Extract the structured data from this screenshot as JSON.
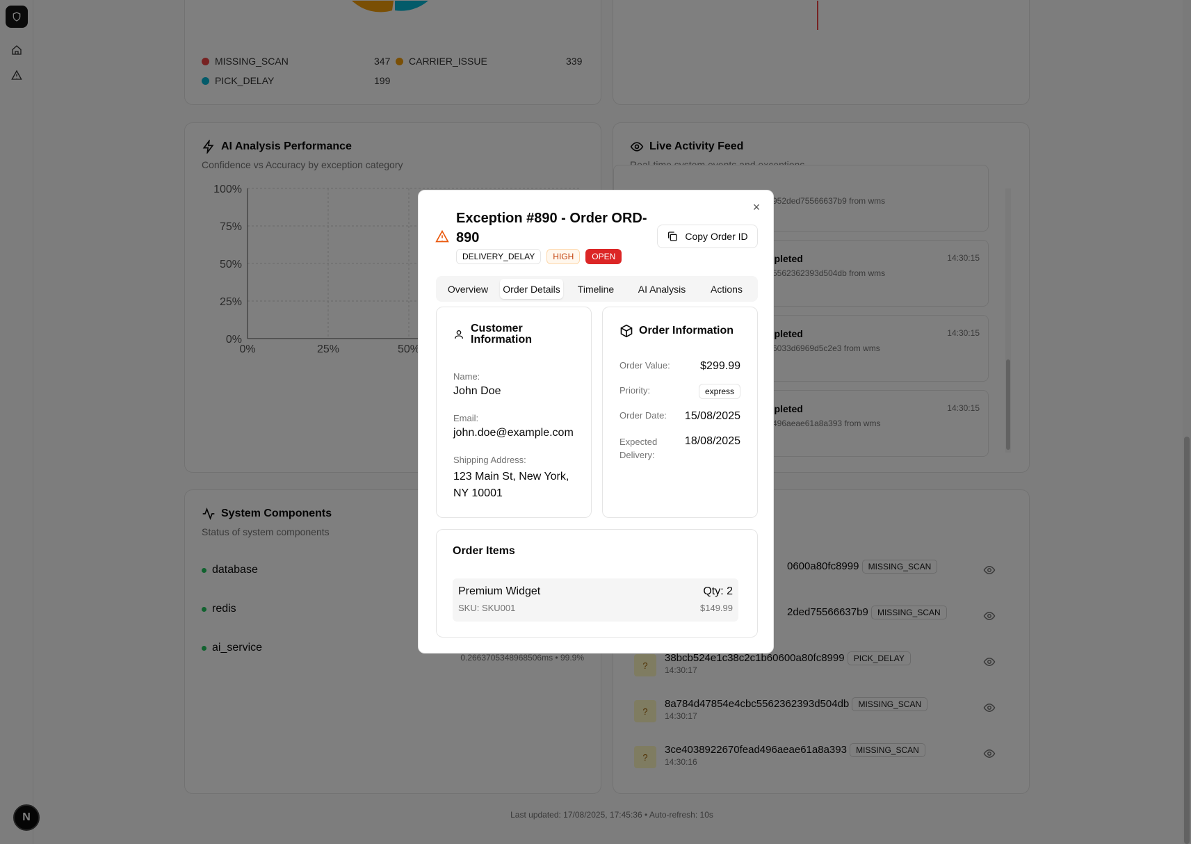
{
  "background": {
    "legend": [
      {
        "name": "MISSING_SCAN",
        "value": "347",
        "color": "#ef4444"
      },
      {
        "name": "CARRIER_ISSUE",
        "value": "339",
        "color": "#f59e0b"
      },
      {
        "name": "PICK_DELAY",
        "value": "199",
        "color": "#06b6d4"
      }
    ],
    "ai_card": {
      "title": "AI Analysis Performance",
      "subtitle": "Confidence vs Accuracy by exception category",
      "y_ticks": [
        "100%",
        "75%",
        "50%",
        "25%",
        "0%"
      ],
      "x_ticks": [
        "0%",
        "25%",
        "50%"
      ]
    },
    "feed_card": {
      "title": "Live Activity Feed",
      "subtitle": "Real-time system events and exceptions",
      "items": [
        {
          "title": "",
          "sub": "952ded75566637b9 from wms",
          "time": ""
        },
        {
          "title": "npleted",
          "sub": "5562362393d504db from wms",
          "time": "14:30:15"
        },
        {
          "title": "npleted",
          "sub": "6033d6969d5c2e3 from wms",
          "time": "14:30:15"
        },
        {
          "title": "npleted",
          "sub": "496aeae61a8a393 from wms",
          "time": "14:30:15"
        }
      ]
    },
    "components_card": {
      "title": "System Components",
      "subtitle": "Status of system components",
      "items": [
        {
          "name": "database"
        },
        {
          "name": "redis"
        },
        {
          "name": "ai_service",
          "detail": "0.2663705348968506ms • 99.9%"
        }
      ]
    },
    "exceptions": [
      {
        "id": "0600a80fc8999",
        "time": "",
        "tag": "MISSING_SCAN"
      },
      {
        "id": "2ded75566637b9",
        "time": "",
        "tag": "MISSING_SCAN"
      },
      {
        "id": "38bcb524e1c38c2c1b60600a80fc8999",
        "time": "14:30:17",
        "tag": "PICK_DELAY"
      },
      {
        "id": "8a784d47854e4cbc5562362393d504db",
        "time": "14:30:17",
        "tag": "MISSING_SCAN"
      },
      {
        "id": "3ce4038922670fead496aeae61a8a393",
        "time": "14:30:16",
        "tag": "MISSING_SCAN"
      }
    ],
    "footer": "Last updated: 17/08/2025, 17:45:36 • Auto-refresh: 10s",
    "badge_letter": "N"
  },
  "modal": {
    "title": "Exception #890 - Order ORD-890",
    "badges": {
      "type": "DELIVERY_DELAY",
      "severity": "HIGH",
      "status": "OPEN"
    },
    "copy_label": "Copy Order ID",
    "close_glyph": "×",
    "tabs": [
      "Overview",
      "Order Details",
      "Timeline",
      "AI Analysis",
      "Actions"
    ],
    "active_tab": "Order Details",
    "customer": {
      "title": "Customer Information",
      "name_label": "Name:",
      "name": "John Doe",
      "email_label": "Email:",
      "email": "john.doe@example.com",
      "address_label": "Shipping Address:",
      "address": "123 Main St, New York, NY 10001"
    },
    "order": {
      "title": "Order Information",
      "value_label": "Order Value:",
      "value": "$299.99",
      "priority_label": "Priority:",
      "priority": "express",
      "date_label": "Order Date:",
      "date": "15/08/2025",
      "delivery_label": "Expected Delivery:",
      "delivery": "18/08/2025"
    },
    "items": {
      "title": "Order Items",
      "list": [
        {
          "name": "Premium Widget",
          "sku": "SKU: SKU001",
          "qty": "Qty: 2",
          "price": "$149.99"
        }
      ]
    }
  }
}
